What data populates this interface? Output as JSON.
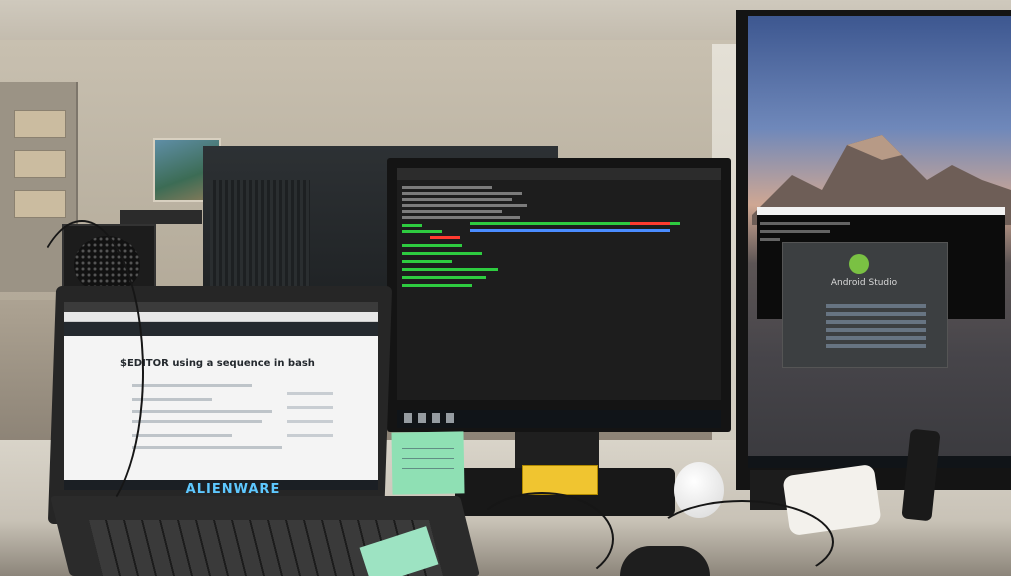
{
  "scene": {
    "laptop": {
      "brand": "ALIENWARE",
      "browser": {
        "page_title": "$EDITOR using a sequence in bash"
      }
    },
    "center_monitor": {
      "app": "terminal"
    },
    "right_monitor": {
      "dialog_title": "Android Studio"
    }
  }
}
